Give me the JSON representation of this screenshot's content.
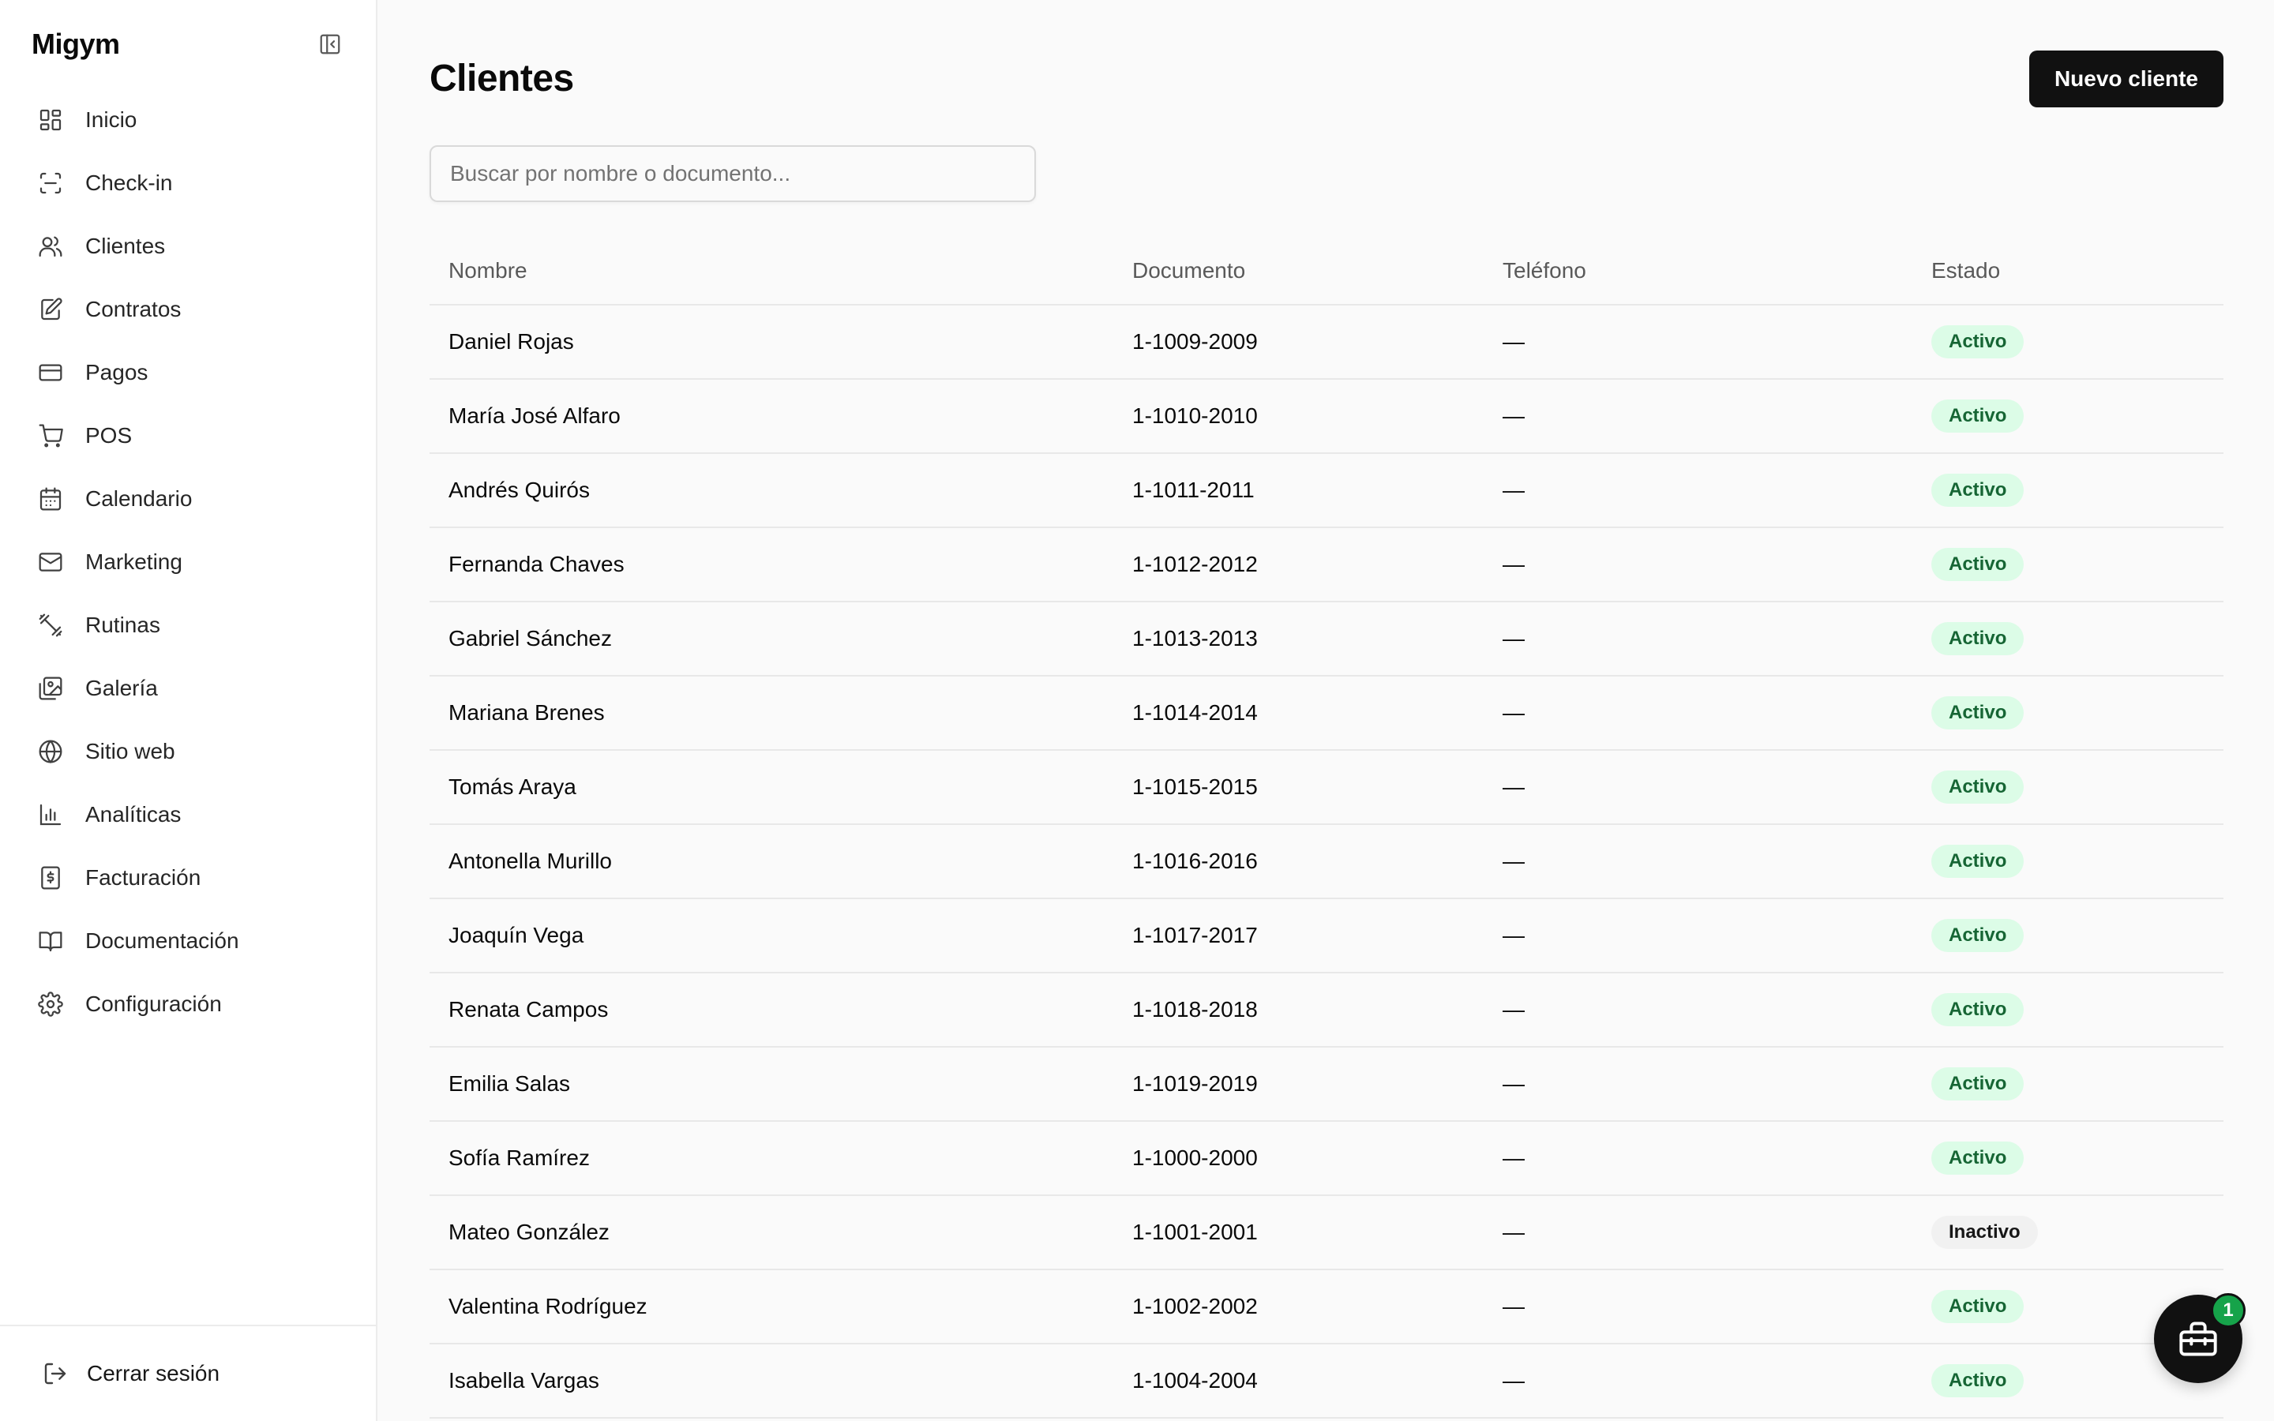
{
  "sidebar": {
    "brand": "Migym",
    "items": [
      {
        "label": "Inicio",
        "icon": "dashboard-icon"
      },
      {
        "label": "Check-in",
        "icon": "scan-icon"
      },
      {
        "label": "Clientes",
        "icon": "users-icon"
      },
      {
        "label": "Contratos",
        "icon": "contract-icon"
      },
      {
        "label": "Pagos",
        "icon": "credit-card-icon"
      },
      {
        "label": "POS",
        "icon": "cart-icon"
      },
      {
        "label": "Calendario",
        "icon": "calendar-icon"
      },
      {
        "label": "Marketing",
        "icon": "mail-icon"
      },
      {
        "label": "Rutinas",
        "icon": "dumbbell-icon"
      },
      {
        "label": "Galería",
        "icon": "gallery-icon"
      },
      {
        "label": "Sitio web",
        "icon": "globe-icon"
      },
      {
        "label": "Analíticas",
        "icon": "bar-chart-icon"
      },
      {
        "label": "Facturación",
        "icon": "receipt-icon"
      },
      {
        "label": "Documentación",
        "icon": "book-icon"
      },
      {
        "label": "Configuración",
        "icon": "gear-icon"
      }
    ],
    "logout_label": "Cerrar sesión"
  },
  "main": {
    "title": "Clientes",
    "new_button": "Nuevo cliente",
    "search_placeholder": "Buscar por nombre o documento...",
    "columns": [
      "Nombre",
      "Documento",
      "Teléfono",
      "Estado"
    ],
    "rows": [
      {
        "name": "Daniel Rojas",
        "doc": "1-1009-2009",
        "phone": "—",
        "status": "Activo"
      },
      {
        "name": "María José Alfaro",
        "doc": "1-1010-2010",
        "phone": "—",
        "status": "Activo"
      },
      {
        "name": "Andrés Quirós",
        "doc": "1-1011-2011",
        "phone": "—",
        "status": "Activo"
      },
      {
        "name": "Fernanda Chaves",
        "doc": "1-1012-2012",
        "phone": "—",
        "status": "Activo"
      },
      {
        "name": "Gabriel Sánchez",
        "doc": "1-1013-2013",
        "phone": "—",
        "status": "Activo"
      },
      {
        "name": "Mariana Brenes",
        "doc": "1-1014-2014",
        "phone": "—",
        "status": "Activo"
      },
      {
        "name": "Tomás Araya",
        "doc": "1-1015-2015",
        "phone": "—",
        "status": "Activo"
      },
      {
        "name": "Antonella Murillo",
        "doc": "1-1016-2016",
        "phone": "—",
        "status": "Activo"
      },
      {
        "name": "Joaquín Vega",
        "doc": "1-1017-2017",
        "phone": "—",
        "status": "Activo"
      },
      {
        "name": "Renata Campos",
        "doc": "1-1018-2018",
        "phone": "—",
        "status": "Activo"
      },
      {
        "name": "Emilia Salas",
        "doc": "1-1019-2019",
        "phone": "—",
        "status": "Activo"
      },
      {
        "name": "Sofía Ramírez",
        "doc": "1-1000-2000",
        "phone": "—",
        "status": "Activo"
      },
      {
        "name": "Mateo González",
        "doc": "1-1001-2001",
        "phone": "—",
        "status": "Inactivo"
      },
      {
        "name": "Valentina Rodríguez",
        "doc": "1-1002-2002",
        "phone": "—",
        "status": "Activo"
      },
      {
        "name": "Isabella Vargas",
        "doc": "1-1004-2004",
        "phone": "—",
        "status": "Activo"
      }
    ]
  },
  "fab": {
    "badge_count": "1",
    "icon": "toolbox-icon"
  },
  "colors": {
    "primary": "#111111",
    "active_badge_bg": "#dcfce7",
    "active_badge_text": "#166534",
    "fab_badge": "#16a34a"
  }
}
